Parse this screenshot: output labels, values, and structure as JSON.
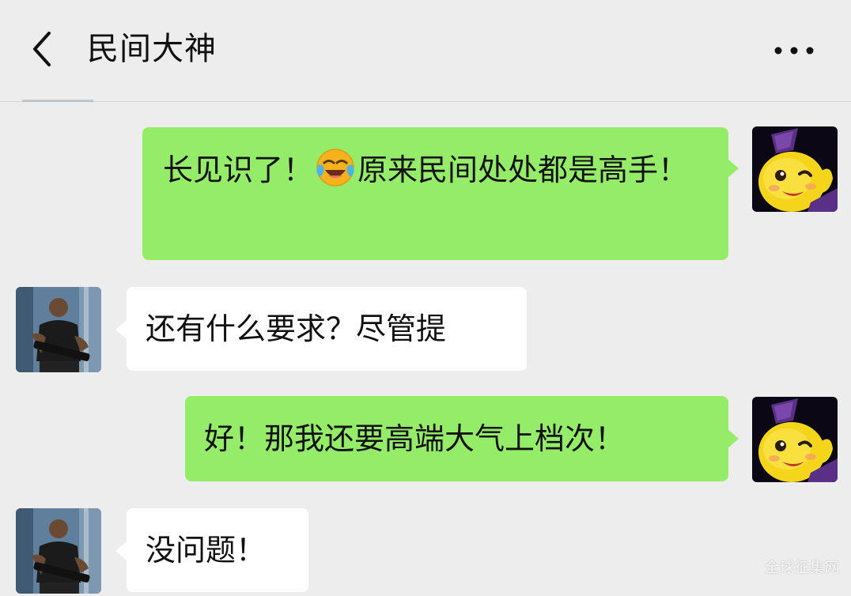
{
  "header": {
    "title": "民间大神",
    "back_icon": "chevron-left-icon",
    "more_icon": "more-dots-icon"
  },
  "messages": [
    {
      "sender": "me",
      "text_before": "长见识了！",
      "emoji": "face-with-tears-of-joy-emoji",
      "text_after": "原来民间处处都是高手！"
    },
    {
      "sender": "other",
      "text": "还有什么要求？尽管提"
    },
    {
      "sender": "me",
      "text": "好！那我还要高端大气上档次！"
    },
    {
      "sender": "other",
      "text": "没问题！"
    }
  ],
  "watermark": "全球征集网",
  "colors": {
    "background": "#ededed",
    "my_bubble": "#95ec69",
    "other_bubble": "#ffffff"
  }
}
